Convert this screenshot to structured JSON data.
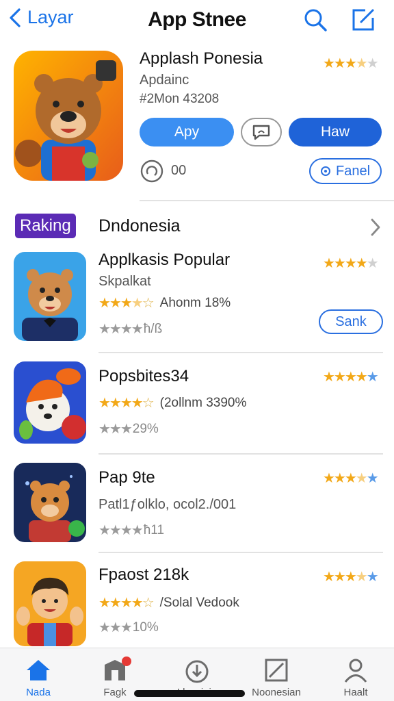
{
  "nav": {
    "back_label": "Layar",
    "title": "App Stnee",
    "search_icon": "search-icon",
    "compose_icon": "compose-icon"
  },
  "featured": {
    "name": "Applash Ponesia",
    "subtitle": "Apdainc",
    "id_text": "#2Mon 43208",
    "rating_stars": 3.5,
    "primary_button": "Apy",
    "chat_icon": "chat-bubble-icon",
    "secondary_button": "Haw",
    "count": "00",
    "fanel_button": "Fanel"
  },
  "section": {
    "badge": "Raking",
    "title": "Dndonesia"
  },
  "list": [
    {
      "name": "Applkasis Popular",
      "subtitle": "Skpalkat",
      "rating_text": "Ahonm 18%",
      "gray_text": "ћ/ß",
      "right_stars": 4,
      "action": "Sank"
    },
    {
      "name": "Popsbites34",
      "rating_text": "(2ollnm 3390%",
      "gray_text": "29%",
      "right_stars": 4.5
    },
    {
      "name": "Pap 9te",
      "subtitle": "Patl1ƒolklo, ocol2./001",
      "gray_text": "ћ11",
      "right_stars": 3.5
    },
    {
      "name": "Fpaost 218k",
      "rating_text": "/Solal Vedook",
      "gray_text": "10%",
      "right_stars": 3.5
    }
  ],
  "tabbar": {
    "items": [
      {
        "label": "Nada",
        "icon": "home-icon",
        "active": true
      },
      {
        "label": "Fagk",
        "icon": "store-icon",
        "active": false
      },
      {
        "label": "Lbrariaia",
        "icon": "cloud-download-icon",
        "active": false
      },
      {
        "label": "Noonesian",
        "icon": "edit-icon",
        "active": false
      },
      {
        "label": "Haalt",
        "icon": "person-icon",
        "active": false
      }
    ]
  },
  "colors": {
    "accent": "#1a73e8",
    "primary_button": "#3b8ff2",
    "secondary_button": "#1f63d8",
    "badge": "#5b2bb5",
    "star": "#f2a818"
  }
}
